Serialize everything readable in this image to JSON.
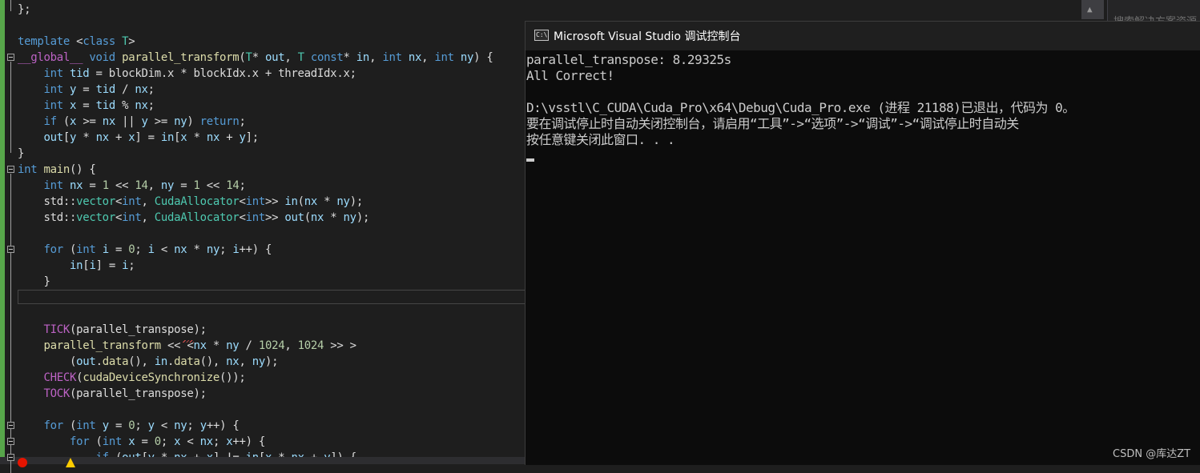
{
  "editor": {
    "lines": [
      {
        "segments": [
          {
            "c": "pl",
            "t": "};"
          }
        ]
      },
      {
        "segments": [
          {
            "c": "pl",
            "t": ""
          }
        ]
      },
      {
        "segments": [
          {
            "c": "kw",
            "t": "template "
          },
          {
            "c": "pl",
            "t": "<"
          },
          {
            "c": "kw",
            "t": "class "
          },
          {
            "c": "ty",
            "t": "T"
          },
          {
            "c": "pl",
            "t": ">"
          }
        ]
      },
      {
        "segments": [
          {
            "c": "mac",
            "t": "__global__ "
          },
          {
            "c": "kw",
            "t": "void "
          },
          {
            "c": "fn",
            "t": "parallel_transform"
          },
          {
            "c": "pl",
            "t": "("
          },
          {
            "c": "ty",
            "t": "T"
          },
          {
            "c": "pl",
            "t": "* "
          },
          {
            "c": "vr",
            "t": "out"
          },
          {
            "c": "pl",
            "t": ", "
          },
          {
            "c": "ty",
            "t": "T "
          },
          {
            "c": "kw",
            "t": "const"
          },
          {
            "c": "pl",
            "t": "* "
          },
          {
            "c": "vr",
            "t": "in"
          },
          {
            "c": "pl",
            "t": ", "
          },
          {
            "c": "kw",
            "t": "int "
          },
          {
            "c": "vr",
            "t": "nx"
          },
          {
            "c": "pl",
            "t": ", "
          },
          {
            "c": "kw",
            "t": "int "
          },
          {
            "c": "vr",
            "t": "ny"
          },
          {
            "c": "pl",
            "t": ") {"
          }
        ]
      },
      {
        "segments": [
          {
            "c": "pl",
            "t": "    "
          },
          {
            "c": "kw",
            "t": "int "
          },
          {
            "c": "vr",
            "t": "tid"
          },
          {
            "c": "pl",
            "t": " = blockDim.x * blockIdx.x + threadIdx.x;"
          }
        ]
      },
      {
        "segments": [
          {
            "c": "pl",
            "t": "    "
          },
          {
            "c": "kw",
            "t": "int "
          },
          {
            "c": "vr",
            "t": "y"
          },
          {
            "c": "pl",
            "t": " = "
          },
          {
            "c": "vr",
            "t": "tid"
          },
          {
            "c": "pl",
            "t": " / "
          },
          {
            "c": "vr",
            "t": "nx"
          },
          {
            "c": "pl",
            "t": ";"
          }
        ]
      },
      {
        "segments": [
          {
            "c": "pl",
            "t": "    "
          },
          {
            "c": "kw",
            "t": "int "
          },
          {
            "c": "vr",
            "t": "x"
          },
          {
            "c": "pl",
            "t": " = "
          },
          {
            "c": "vr",
            "t": "tid"
          },
          {
            "c": "pl",
            "t": " % "
          },
          {
            "c": "vr",
            "t": "nx"
          },
          {
            "c": "pl",
            "t": ";"
          }
        ]
      },
      {
        "segments": [
          {
            "c": "pl",
            "t": "    "
          },
          {
            "c": "kw",
            "t": "if "
          },
          {
            "c": "pl",
            "t": "("
          },
          {
            "c": "vr",
            "t": "x"
          },
          {
            "c": "pl",
            "t": " >= "
          },
          {
            "c": "vr",
            "t": "nx"
          },
          {
            "c": "pl",
            "t": " || "
          },
          {
            "c": "vr",
            "t": "y"
          },
          {
            "c": "pl",
            "t": " >= "
          },
          {
            "c": "vr",
            "t": "ny"
          },
          {
            "c": "pl",
            "t": ") "
          },
          {
            "c": "kw",
            "t": "return"
          },
          {
            "c": "pl",
            "t": ";"
          }
        ]
      },
      {
        "segments": [
          {
            "c": "pl",
            "t": "    "
          },
          {
            "c": "vr",
            "t": "out"
          },
          {
            "c": "pl",
            "t": "["
          },
          {
            "c": "vr",
            "t": "y"
          },
          {
            "c": "pl",
            "t": " * "
          },
          {
            "c": "vr",
            "t": "nx"
          },
          {
            "c": "pl",
            "t": " + "
          },
          {
            "c": "vr",
            "t": "x"
          },
          {
            "c": "pl",
            "t": "] = "
          },
          {
            "c": "vr",
            "t": "in"
          },
          {
            "c": "pl",
            "t": "["
          },
          {
            "c": "vr",
            "t": "x"
          },
          {
            "c": "pl",
            "t": " * "
          },
          {
            "c": "vr",
            "t": "nx"
          },
          {
            "c": "pl",
            "t": " + "
          },
          {
            "c": "vr",
            "t": "y"
          },
          {
            "c": "pl",
            "t": "];"
          }
        ]
      },
      {
        "segments": [
          {
            "c": "pl",
            "t": "}"
          }
        ]
      },
      {
        "segments": [
          {
            "c": "kw",
            "t": "int "
          },
          {
            "c": "fn",
            "t": "main"
          },
          {
            "c": "pl",
            "t": "() {"
          }
        ]
      },
      {
        "segments": [
          {
            "c": "pl",
            "t": "    "
          },
          {
            "c": "kw",
            "t": "int "
          },
          {
            "c": "vr",
            "t": "nx"
          },
          {
            "c": "pl",
            "t": " = "
          },
          {
            "c": "nm",
            "t": "1"
          },
          {
            "c": "pl",
            "t": " << "
          },
          {
            "c": "nm",
            "t": "14"
          },
          {
            "c": "pl",
            "t": ", "
          },
          {
            "c": "vr",
            "t": "ny"
          },
          {
            "c": "pl",
            "t": " = "
          },
          {
            "c": "nm",
            "t": "1"
          },
          {
            "c": "pl",
            "t": " << "
          },
          {
            "c": "nm",
            "t": "14"
          },
          {
            "c": "pl",
            "t": ";"
          }
        ]
      },
      {
        "segments": [
          {
            "c": "pl",
            "t": "    std::"
          },
          {
            "c": "ty",
            "t": "vector"
          },
          {
            "c": "pl",
            "t": "<"
          },
          {
            "c": "kw",
            "t": "int"
          },
          {
            "c": "pl",
            "t": ", "
          },
          {
            "c": "ty",
            "t": "CudaAllocator"
          },
          {
            "c": "pl",
            "t": "<"
          },
          {
            "c": "kw",
            "t": "int"
          },
          {
            "c": "pl",
            "t": ">> "
          },
          {
            "c": "vr",
            "t": "in"
          },
          {
            "c": "pl",
            "t": "("
          },
          {
            "c": "vr",
            "t": "nx"
          },
          {
            "c": "pl",
            "t": " * "
          },
          {
            "c": "vr",
            "t": "ny"
          },
          {
            "c": "pl",
            "t": ");"
          }
        ]
      },
      {
        "segments": [
          {
            "c": "pl",
            "t": "    std::"
          },
          {
            "c": "ty",
            "t": "vector"
          },
          {
            "c": "pl",
            "t": "<"
          },
          {
            "c": "kw",
            "t": "int"
          },
          {
            "c": "pl",
            "t": ", "
          },
          {
            "c": "ty",
            "t": "CudaAllocator"
          },
          {
            "c": "pl",
            "t": "<"
          },
          {
            "c": "kw",
            "t": "int"
          },
          {
            "c": "pl",
            "t": ">> "
          },
          {
            "c": "vr",
            "t": "out"
          },
          {
            "c": "pl",
            "t": "("
          },
          {
            "c": "vr",
            "t": "nx"
          },
          {
            "c": "pl",
            "t": " * "
          },
          {
            "c": "vr",
            "t": "ny"
          },
          {
            "c": "pl",
            "t": ");"
          }
        ]
      },
      {
        "segments": [
          {
            "c": "pl",
            "t": ""
          }
        ]
      },
      {
        "segments": [
          {
            "c": "pl",
            "t": "    "
          },
          {
            "c": "kw",
            "t": "for "
          },
          {
            "c": "pl",
            "t": "("
          },
          {
            "c": "kw",
            "t": "int "
          },
          {
            "c": "vr",
            "t": "i"
          },
          {
            "c": "pl",
            "t": " = "
          },
          {
            "c": "nm",
            "t": "0"
          },
          {
            "c": "pl",
            "t": "; "
          },
          {
            "c": "vr",
            "t": "i"
          },
          {
            "c": "pl",
            "t": " < "
          },
          {
            "c": "vr",
            "t": "nx"
          },
          {
            "c": "pl",
            "t": " * "
          },
          {
            "c": "vr",
            "t": "ny"
          },
          {
            "c": "pl",
            "t": "; "
          },
          {
            "c": "vr",
            "t": "i"
          },
          {
            "c": "pl",
            "t": "++) {"
          }
        ]
      },
      {
        "segments": [
          {
            "c": "pl",
            "t": "        "
          },
          {
            "c": "vr",
            "t": "in"
          },
          {
            "c": "pl",
            "t": "["
          },
          {
            "c": "vr",
            "t": "i"
          },
          {
            "c": "pl",
            "t": "] = "
          },
          {
            "c": "vr",
            "t": "i"
          },
          {
            "c": "pl",
            "t": ";"
          }
        ]
      },
      {
        "segments": [
          {
            "c": "pl",
            "t": "    }"
          }
        ]
      },
      {
        "segments": [
          {
            "c": "pl",
            "t": ""
          }
        ]
      },
      {
        "segments": [
          {
            "c": "pl",
            "t": ""
          }
        ]
      },
      {
        "segments": [
          {
            "c": "pl",
            "t": "    "
          },
          {
            "c": "mac",
            "t": "TICK"
          },
          {
            "c": "pl",
            "t": "(parallel_transpose);"
          }
        ]
      },
      {
        "segments": [
          {
            "c": "pl",
            "t": "    "
          },
          {
            "c": "fn",
            "t": "parallel_transform"
          },
          {
            "c": "pl",
            "t": " << <"
          },
          {
            "c": "vr",
            "t": "nx"
          },
          {
            "c": "pl",
            "t": " * "
          },
          {
            "c": "vr",
            "t": "ny"
          },
          {
            "c": "pl",
            "t": " / "
          },
          {
            "c": "nm",
            "t": "1024"
          },
          {
            "c": "pl",
            "t": ", "
          },
          {
            "c": "nm",
            "t": "1024"
          },
          {
            "c": "pl",
            "t": " >> >"
          }
        ]
      },
      {
        "segments": [
          {
            "c": "pl",
            "t": "        ("
          },
          {
            "c": "vr",
            "t": "out"
          },
          {
            "c": "pl",
            "t": "."
          },
          {
            "c": "fn",
            "t": "data"
          },
          {
            "c": "pl",
            "t": "(), "
          },
          {
            "c": "vr",
            "t": "in"
          },
          {
            "c": "pl",
            "t": "."
          },
          {
            "c": "fn",
            "t": "data"
          },
          {
            "c": "pl",
            "t": "(), "
          },
          {
            "c": "vr",
            "t": "nx"
          },
          {
            "c": "pl",
            "t": ", "
          },
          {
            "c": "vr",
            "t": "ny"
          },
          {
            "c": "pl",
            "t": ");"
          }
        ]
      },
      {
        "segments": [
          {
            "c": "pl",
            "t": "    "
          },
          {
            "c": "mac",
            "t": "CHECK"
          },
          {
            "c": "pl",
            "t": "("
          },
          {
            "c": "fn",
            "t": "cudaDeviceSynchronize"
          },
          {
            "c": "pl",
            "t": "());"
          }
        ]
      },
      {
        "segments": [
          {
            "c": "pl",
            "t": "    "
          },
          {
            "c": "mac",
            "t": "TOCK"
          },
          {
            "c": "pl",
            "t": "(parallel_transpose);"
          }
        ]
      },
      {
        "segments": [
          {
            "c": "pl",
            "t": ""
          }
        ]
      },
      {
        "segments": [
          {
            "c": "pl",
            "t": "    "
          },
          {
            "c": "kw",
            "t": "for "
          },
          {
            "c": "pl",
            "t": "("
          },
          {
            "c": "kw",
            "t": "int "
          },
          {
            "c": "vr",
            "t": "y"
          },
          {
            "c": "pl",
            "t": " = "
          },
          {
            "c": "nm",
            "t": "0"
          },
          {
            "c": "pl",
            "t": "; "
          },
          {
            "c": "vr",
            "t": "y"
          },
          {
            "c": "pl",
            "t": " < "
          },
          {
            "c": "vr",
            "t": "ny"
          },
          {
            "c": "pl",
            "t": "; "
          },
          {
            "c": "vr",
            "t": "y"
          },
          {
            "c": "pl",
            "t": "++) {"
          }
        ]
      },
      {
        "segments": [
          {
            "c": "pl",
            "t": "        "
          },
          {
            "c": "kw",
            "t": "for "
          },
          {
            "c": "pl",
            "t": "("
          },
          {
            "c": "kw",
            "t": "int "
          },
          {
            "c": "vr",
            "t": "x"
          },
          {
            "c": "pl",
            "t": " = "
          },
          {
            "c": "nm",
            "t": "0"
          },
          {
            "c": "pl",
            "t": "; "
          },
          {
            "c": "vr",
            "t": "x"
          },
          {
            "c": "pl",
            "t": " < "
          },
          {
            "c": "vr",
            "t": "nx"
          },
          {
            "c": "pl",
            "t": "; "
          },
          {
            "c": "vr",
            "t": "x"
          },
          {
            "c": "pl",
            "t": "++) {"
          }
        ]
      },
      {
        "segments": [
          {
            "c": "pl",
            "t": "            "
          },
          {
            "c": "kw",
            "t": "if "
          },
          {
            "c": "pl",
            "t": "("
          },
          {
            "c": "vr",
            "t": "out"
          },
          {
            "c": "pl",
            "t": "["
          },
          {
            "c": "vr",
            "t": "y"
          },
          {
            "c": "pl",
            "t": " * "
          },
          {
            "c": "vr",
            "t": "nx"
          },
          {
            "c": "pl",
            "t": " + "
          },
          {
            "c": "vr",
            "t": "x"
          },
          {
            "c": "pl",
            "t": "] != "
          },
          {
            "c": "vr",
            "t": "in"
          },
          {
            "c": "pl",
            "t": "["
          },
          {
            "c": "vr",
            "t": "x"
          },
          {
            "c": "pl",
            "t": " * "
          },
          {
            "c": "vr",
            "t": "nx"
          },
          {
            "c": "pl",
            "t": " + "
          },
          {
            "c": "vr",
            "t": "y"
          },
          {
            "c": "pl",
            "t": "]) {"
          }
        ]
      }
    ],
    "right_panel_search": "搜索解决方案资源"
  },
  "console": {
    "title": "Microsoft Visual Studio 调试控制台",
    "icon_label": "C:\\",
    "lines": [
      "parallel_transpose: 8.29325s",
      "All Correct!",
      "",
      "D:\\vsstl\\C_CUDA\\Cuda_Pro\\x64\\Debug\\Cuda_Pro.exe (进程 21188)已退出，代码为 0。",
      "要在调试停止时自动关闭控制台，请启用“工具”->“选项”->“调试”->“调试停止时自动关",
      "按任意键关闭此窗口. . ."
    ]
  },
  "watermark": "CSDN @库达ZT",
  "colors": {
    "editor_bg": "#1e1e1e",
    "console_bg": "#0c0c0c",
    "keyword": "#569cd6",
    "type": "#4ec9b0",
    "function": "#dcdcaa",
    "variable": "#9cdcfe",
    "macro": "#bd63c5",
    "number": "#b5cea8"
  },
  "icons": [
    "console-app-icon",
    "error-icon",
    "warning-icon",
    "collapse-icon"
  ]
}
